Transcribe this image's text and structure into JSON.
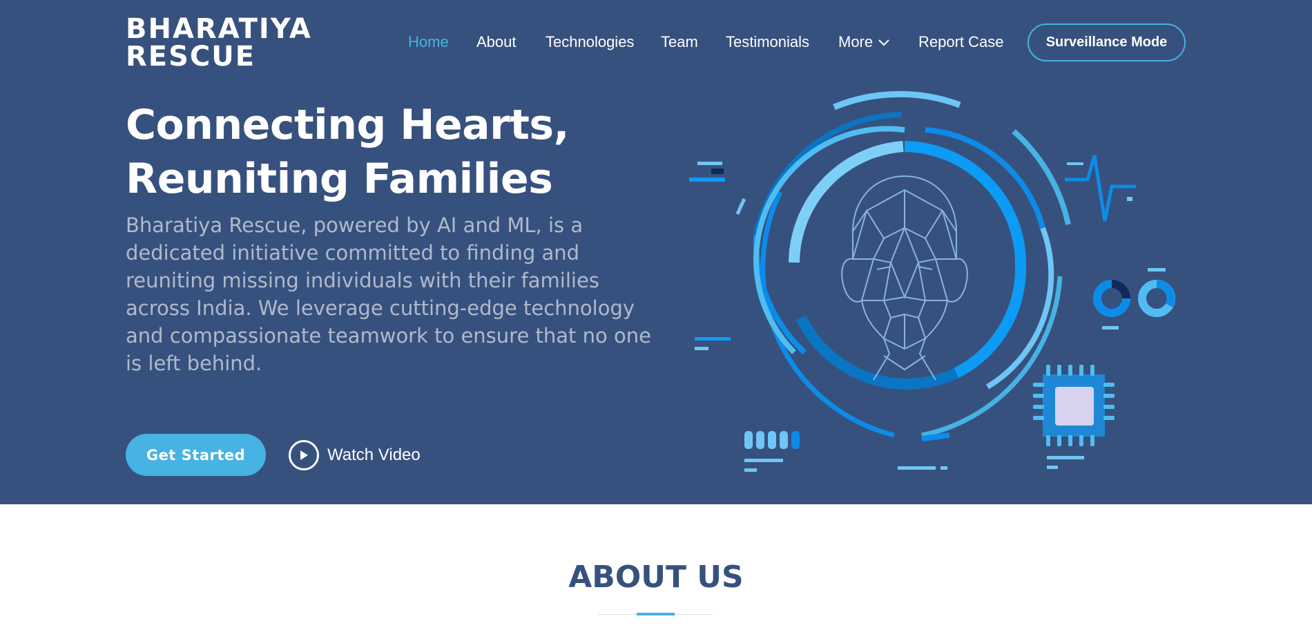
{
  "brand": {
    "line1": "BHARATIYA",
    "line2": "RESCUE"
  },
  "nav": {
    "items": [
      {
        "label": "Home",
        "active": true
      },
      {
        "label": "About"
      },
      {
        "label": "Technologies"
      },
      {
        "label": "Team"
      },
      {
        "label": "Testimonials"
      },
      {
        "label": "More"
      },
      {
        "label": "Report Case"
      }
    ],
    "more_icon": "chevron-down-icon",
    "surveillance_label": "Surveillance Mode"
  },
  "hero": {
    "headline_line1": "Connecting Hearts,",
    "headline_line2": "Reuniting Families",
    "description": "Bharatiya Rescue, powered by AI and ML, is a dedicated initiative committed to finding and reuniting missing individuals with their families across India. We leverage cutting-edge technology and compassionate teamwork to ensure that no one is left behind.",
    "get_started_label": "Get Started",
    "watch_video_label": "Watch Video",
    "watch_icon": "play-icon",
    "illustration": "face-recognition-illustration"
  },
  "about": {
    "title": "ABOUT US"
  },
  "colors": {
    "hero_bg": "#37517e",
    "accent": "#47b2e4",
    "white": "#ffffff"
  }
}
